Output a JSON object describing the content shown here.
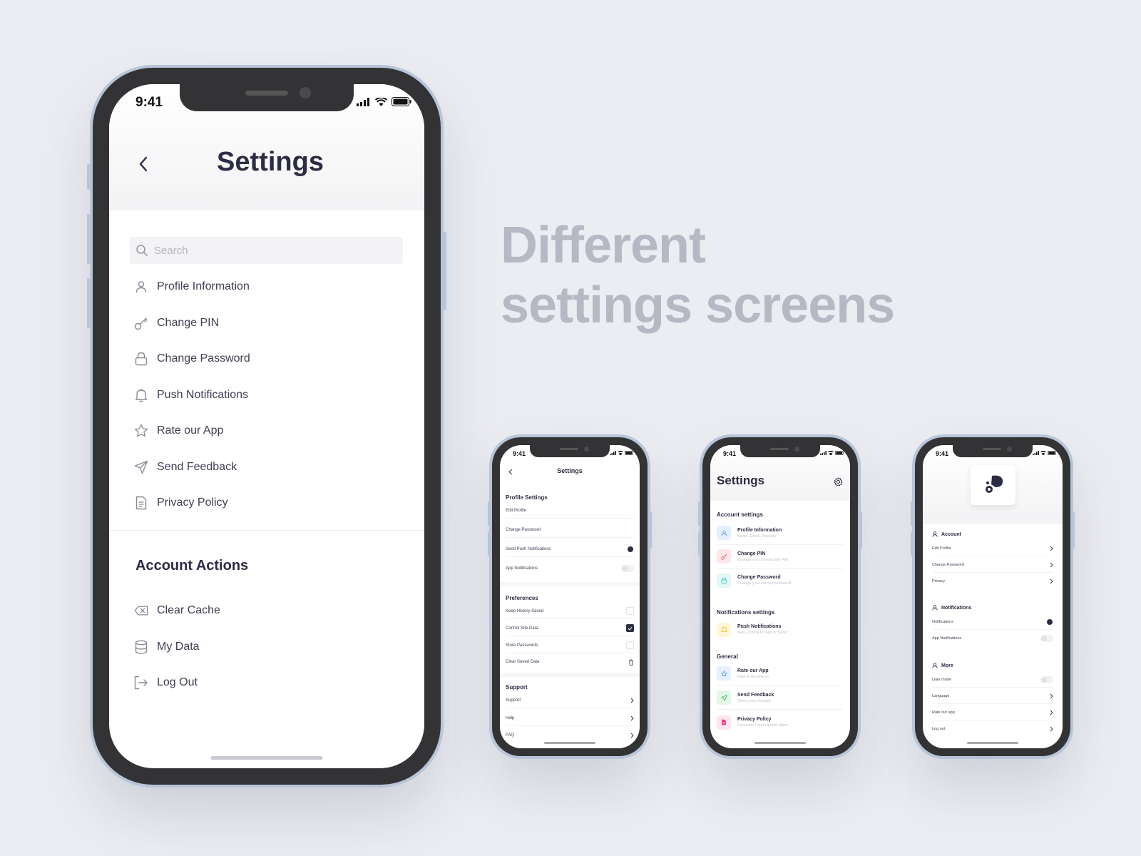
{
  "headline": {
    "line1": "Different",
    "line2": "settings screens"
  },
  "colors": {
    "background": "#ecedf2",
    "frame": "#333335",
    "frame_edge": "#b8c5d8",
    "primary_text": "#2d2c45",
    "headline_text": "#b7b8c4"
  },
  "main_phone": {
    "status_time": "9:41",
    "title": "Settings",
    "search": {
      "placeholder": "Search"
    },
    "items": [
      {
        "label": "Profile Information",
        "icon": "user-icon"
      },
      {
        "label": "Change PIN",
        "icon": "key-icon"
      },
      {
        "label": "Change Password",
        "icon": "lock-icon"
      },
      {
        "label": "Push Notifications",
        "icon": "bell-icon"
      },
      {
        "label": "Rate our App",
        "icon": "star-icon"
      },
      {
        "label": "Send Feedback",
        "icon": "send-icon"
      },
      {
        "label": "Privacy Policy",
        "icon": "document-icon"
      }
    ],
    "account_actions": {
      "title": "Account Actions",
      "items": [
        {
          "label": "Clear Cache",
          "icon": "backspace-icon"
        },
        {
          "label": "My Data",
          "icon": "database-icon"
        },
        {
          "label": "Log Out",
          "icon": "logout-icon"
        }
      ]
    }
  },
  "phone2": {
    "status_time": "9:41",
    "title": "Settings",
    "profile_settings": {
      "title": "Profile Settings",
      "items": [
        "Edit Profile",
        "Change Password",
        "Send Push Notifications",
        "App Notifications"
      ]
    },
    "preferences": {
      "title": "Preferences",
      "items": [
        "Keep History Saved",
        "Control Site Data",
        "Store Passwords",
        "Clear Saved Data"
      ]
    },
    "support": {
      "title": "Support",
      "items": [
        "Support",
        "Help",
        "FAQ"
      ]
    }
  },
  "phone3": {
    "status_time": "9:41",
    "title": "Settings",
    "account_settings": {
      "title": "Account settings",
      "items": [
        {
          "title": "Profile Information",
          "subtitle": "Name, Email, Security"
        },
        {
          "title": "Change PIN",
          "subtitle": "Change your transaction PIN"
        },
        {
          "title": "Change Password",
          "subtitle": "Change your current password"
        }
      ]
    },
    "notifications_settings": {
      "title": "Notifications settings",
      "items": [
        {
          "title": "Push Notifications",
          "subtitle": "New Contracts Sign or Send"
        }
      ]
    },
    "general": {
      "title": "General",
      "items": [
        {
          "title": "Rate our App",
          "subtitle": "Rate & REview us"
        },
        {
          "title": "Send Feedback",
          "subtitle": "Share your thought"
        },
        {
          "title": "Privacy Policy",
          "subtitle": "Generate Lorem ipsum place"
        }
      ]
    }
  },
  "phone4": {
    "status_time": "9:41",
    "account": {
      "title": "Account",
      "items": [
        "Edit Profile",
        "Change Password",
        "Privacy"
      ]
    },
    "notifications": {
      "title": "Notifications",
      "items": [
        "Notifications",
        "App Notifications"
      ]
    },
    "more": {
      "title": "More",
      "items": [
        "Dark mode",
        "Language",
        "Rate our app",
        "Log out"
      ]
    }
  }
}
